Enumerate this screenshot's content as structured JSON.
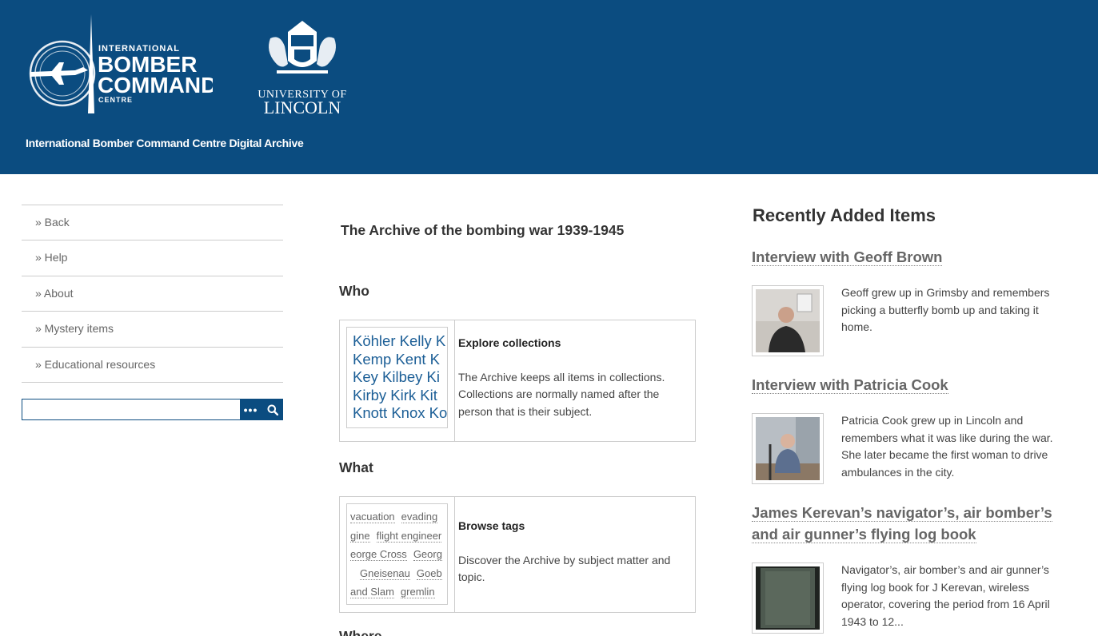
{
  "header": {
    "site_title": "International Bomber Command Centre Digital Archive",
    "bg_color": "#0b4c80",
    "ibcc_logo": {
      "line1": "INTERNATIONAL",
      "line2": "BOMBER",
      "line3": "COMMAND",
      "line4": "CENTRE"
    },
    "lincoln_logo": {
      "line1": "UNIVERSITY OF",
      "line2": "LINCOLN"
    }
  },
  "nav": {
    "items": [
      {
        "label": "» Back"
      },
      {
        "label": "» Help"
      },
      {
        "label": "» About"
      },
      {
        "label": "» Mystery items"
      },
      {
        "label": "» Educational resources"
      }
    ]
  },
  "search": {
    "value": "",
    "options_icon": "ellipsis-icon",
    "submit_icon": "search-icon"
  },
  "main": {
    "heading": "The Archive of the bombing war 1939-1945",
    "sections": [
      {
        "title": "Who",
        "card_title": "Explore collections",
        "card_text": "The Archive keeps all items in collections. Collections are normally named after the person that is their subject.",
        "thumb_lines": [
          "Köhler Kelly K",
          "Kemp Kent K",
          "Key Kilbey Ki",
          "Kirby Kirk Kit",
          "Knott Knox Ko"
        ]
      },
      {
        "title": "What",
        "card_title": "Browse tags",
        "card_text": "Discover the Archive by subject matter and topic.",
        "thumb_tags": [
          [
            "vacuation",
            "evading"
          ],
          [
            "gine",
            "flight engineer"
          ],
          [
            "eorge Cross",
            "Georg"
          ],
          [
            "Gneisenau",
            "Goeb"
          ],
          [
            "and Slam",
            "gremlin"
          ]
        ]
      },
      {
        "title": "Where"
      }
    ]
  },
  "recent": {
    "title": "Recently Added Items",
    "items": [
      {
        "title": "Interview with Geoff Brown",
        "desc": "Geoff grew up in Grimsby and remembers picking a butterfly bomb up and taking it home."
      },
      {
        "title": "Interview with Patricia Cook",
        "desc": "Patricia Cook grew up in Lincoln and remembers what it was like during the war. She later became the first woman to drive ambulances in the city."
      },
      {
        "title": "James Kerevan’s navigator’s, air bomber’s and air gunner’s flying log book",
        "desc": "Navigator’s, air bomber’s and air gunner’s flying log book for J Kerevan, wireless operator, covering the period from 16 April 1943 to 12..."
      }
    ]
  }
}
